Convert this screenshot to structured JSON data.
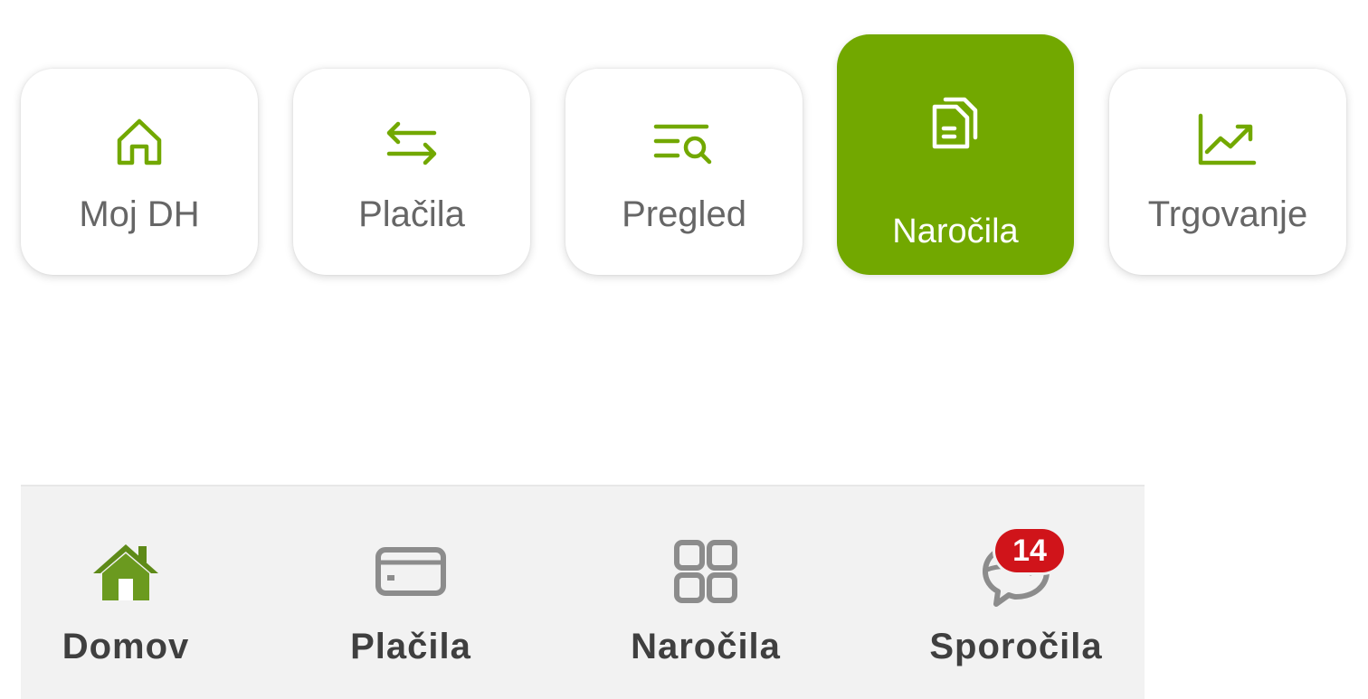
{
  "tiles": [
    {
      "label": "Moj DH",
      "icon": "home-outline-icon",
      "active": false
    },
    {
      "label": "Plačila",
      "icon": "transfer-arrows-icon",
      "active": false
    },
    {
      "label": "Pregled",
      "icon": "list-search-icon",
      "active": false
    },
    {
      "label": "Naročila",
      "icon": "documents-icon",
      "active": true
    },
    {
      "label": "Trgovanje",
      "icon": "trend-chart-icon",
      "active": false
    }
  ],
  "bottom_nav": {
    "items": [
      {
        "label": "Domov",
        "icon": "home-filled-icon",
        "active": true
      },
      {
        "label": "Plačila",
        "icon": "credit-card-icon",
        "active": false
      },
      {
        "label": "Naročila",
        "icon": "grid-icon",
        "active": false
      },
      {
        "label": "Sporočila",
        "icon": "chat-bubble-icon",
        "active": false
      }
    ],
    "messages_badge": "14"
  },
  "colors": {
    "accent": "#72a800",
    "tile_label": "#666666",
    "nav_label": "#3f3f3f",
    "nav_background": "#f2f2f2",
    "badge": "#d0141a",
    "home_icon": "#5e8a18",
    "inactive_icon": "#8c8c8c"
  }
}
